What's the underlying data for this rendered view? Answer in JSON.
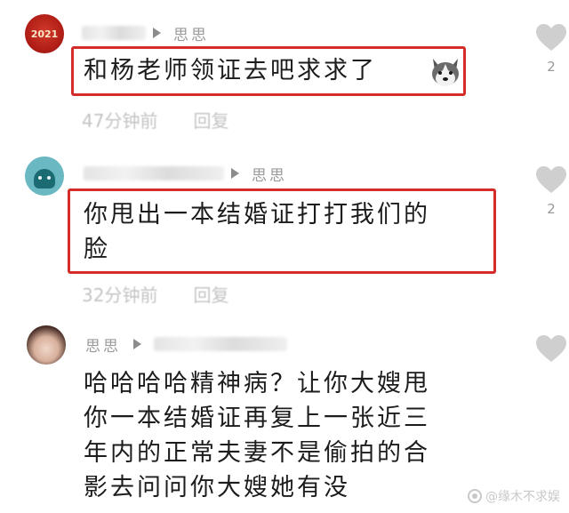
{
  "comments": [
    {
      "avatar_text": "2021",
      "reply_to": "思思",
      "text_lines": [
        "和杨老师领证去吧求求了"
      ],
      "time": "47分钟前",
      "reply_label": "回复",
      "like_count": "2"
    },
    {
      "reply_to": "思思",
      "text_lines": [
        "你甩出一本结婚证打打我们的",
        "脸"
      ],
      "time": "32分钟前",
      "reply_label": "回复",
      "like_count": "2"
    },
    {
      "author": "思思",
      "text_lines": [
        "哈哈哈哈精神病？让你大嫂甩",
        "你一本结婚证再复上一张近三",
        "年内的正常夫妻不是偷拍的合",
        "影去问问你大嫂她有没"
      ]
    }
  ],
  "watermark": "@缘木不求娱"
}
